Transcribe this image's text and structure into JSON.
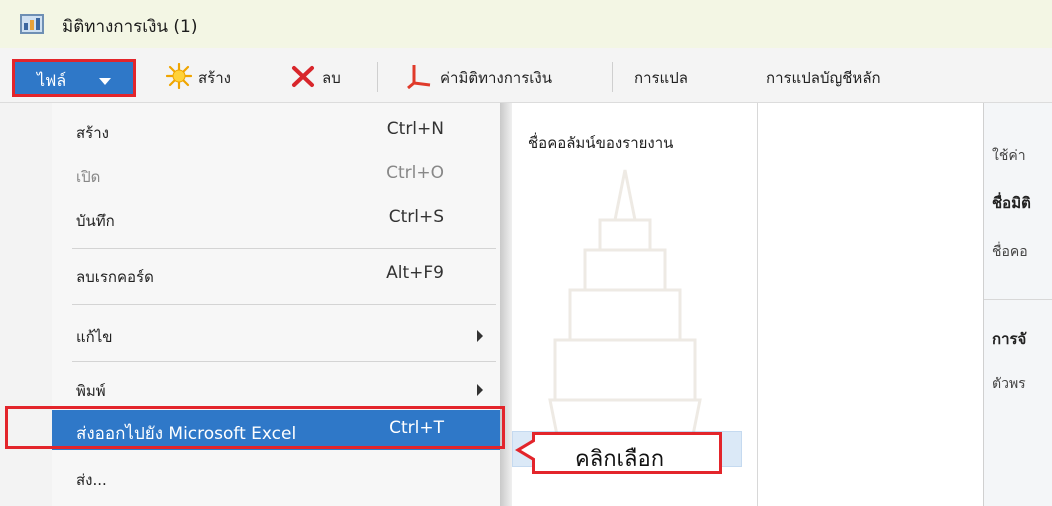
{
  "window": {
    "title": "มิติทางการเงิน (1)"
  },
  "toolbar": {
    "file_label": "ไฟล์",
    "new_label": "สร้าง",
    "delete_label": "ลบ",
    "financial_dim_values_label": "ค่ามิติทางการเงิน",
    "translation_label": "การแปล",
    "main_account_translation_label": "การแปลบัญชีหลัก"
  },
  "file_menu": {
    "items": [
      {
        "label": "สร้าง",
        "shortcut": "Ctrl+N",
        "enabled": true
      },
      {
        "label": "เปิด",
        "shortcut": "Ctrl+O",
        "enabled": false
      },
      {
        "label": "บันทึก",
        "shortcut": "Ctrl+S",
        "enabled": true
      },
      {
        "label": "ลบเรกคอร์ด",
        "shortcut": "Alt+F9",
        "enabled": true
      },
      {
        "label": "แก้ไข",
        "submenu": true
      },
      {
        "label": "พิมพ์",
        "submenu": true
      },
      {
        "label": "ส่งออกไปยัง Microsoft Excel",
        "shortcut": "Ctrl+T",
        "highlighted": true
      },
      {
        "label": "ส่ง..."
      }
    ]
  },
  "grid": {
    "column_header": "ชื่อคอลัมน์ของรายงาน"
  },
  "details_panel": {
    "line1": "ใช้ค่า",
    "line2": "ชื่อมิติ",
    "line3": "ชื่อคอ",
    "section_heading": "การจั",
    "line4": "ตัวพร"
  },
  "annotation": {
    "callout_text": "คลิกเลือก"
  },
  "colors": {
    "accent": "#2f78c8",
    "highlight_frame": "#e3252b",
    "title_bar": "#f3f6e4"
  }
}
